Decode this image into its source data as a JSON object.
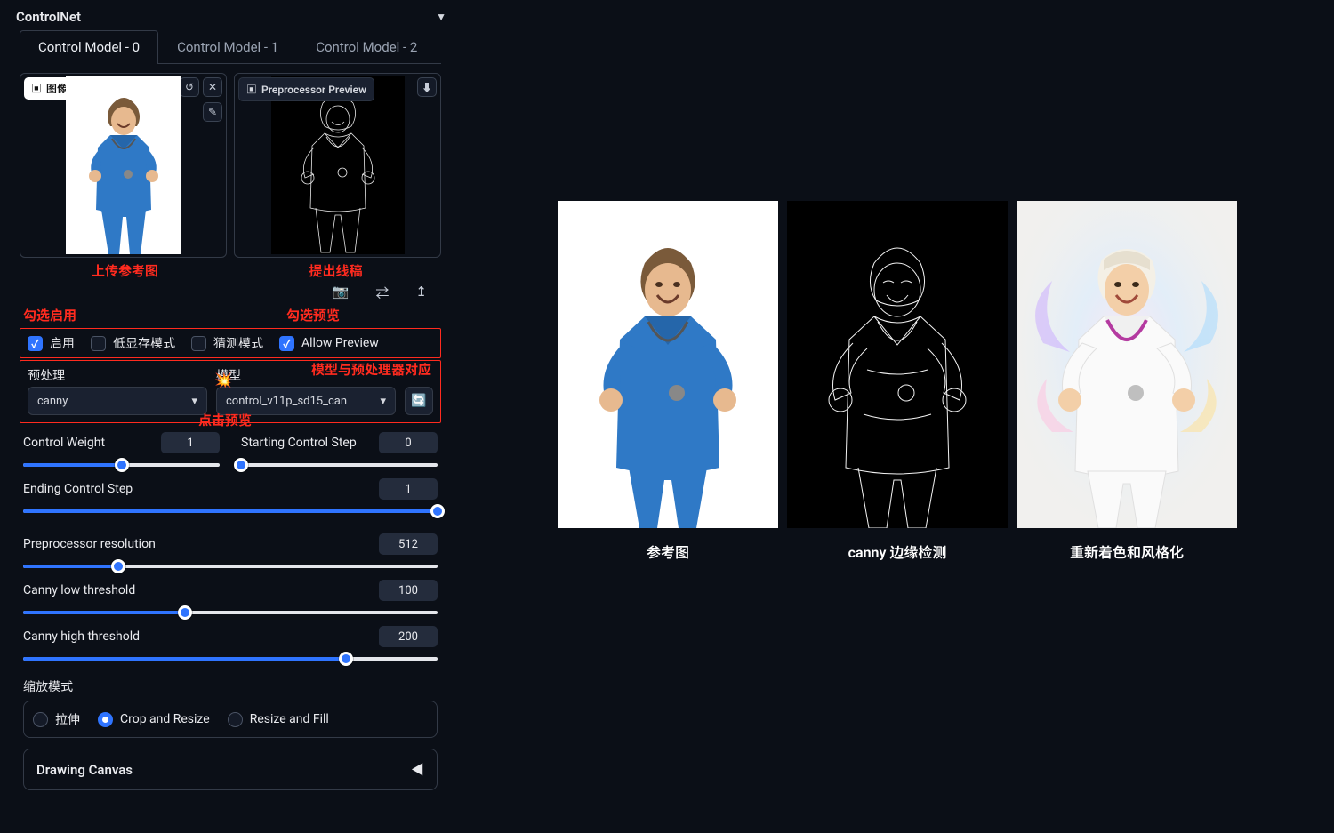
{
  "panel": {
    "title": "ControlNet",
    "tabs": [
      "Control Model - 0",
      "Control Model - 1",
      "Control Model - 2"
    ],
    "activeTab": 0,
    "imageBadge": "图像",
    "previewBadge": "Preprocessor Preview",
    "captions": {
      "upload": "上传参考图",
      "extract": "提出线稿"
    },
    "utilIcons": {
      "camera": "camera-icon",
      "swap": "swap-icon",
      "up": "up-arrow-icon"
    },
    "hints": {
      "enable": "勾选启用",
      "preview": "勾选预览",
      "modelMatch": "模型与预处理器对应",
      "clickPreview": "点击预览"
    },
    "checkboxes": {
      "enable": {
        "label": "启用",
        "checked": true
      },
      "lowvram": {
        "label": "低显存模式",
        "checked": false
      },
      "guess": {
        "label": "猜测模式",
        "checked": false
      },
      "allowPreview": {
        "label": "Allow Preview",
        "checked": true
      }
    },
    "preprocessor": {
      "label": "预处理",
      "value": "canny"
    },
    "model": {
      "label": "模型",
      "value": "control_v11p_sd15_can"
    },
    "sliders": {
      "controlWeight": {
        "label": "Control Weight",
        "value": 1,
        "min": 0,
        "max": 2,
        "pct": 50
      },
      "startStep": {
        "label": "Starting Control Step",
        "value": 0,
        "min": 0,
        "max": 1,
        "pct": 0
      },
      "endStep": {
        "label": "Ending Control Step",
        "value": 1,
        "min": 0,
        "max": 1,
        "pct": 100
      },
      "resolution": {
        "label": "Preprocessor resolution",
        "value": 512,
        "min": 64,
        "max": 2048,
        "pct": 23
      },
      "cannyLow": {
        "label": "Canny low threshold",
        "value": 100,
        "min": 1,
        "max": 255,
        "pct": 39
      },
      "cannyHigh": {
        "label": "Canny high threshold",
        "value": 200,
        "min": 1,
        "max": 255,
        "pct": 78
      }
    },
    "resizeMode": {
      "label": "缩放模式",
      "options": [
        "拉伸",
        "Crop and Resize",
        "Resize and Fill"
      ],
      "selected": 1
    },
    "drawingCanvas": "Drawing Canvas"
  },
  "showcase": {
    "col1": "参考图",
    "col2": "canny 边缘检测",
    "col3": "重新着色和风格化"
  }
}
